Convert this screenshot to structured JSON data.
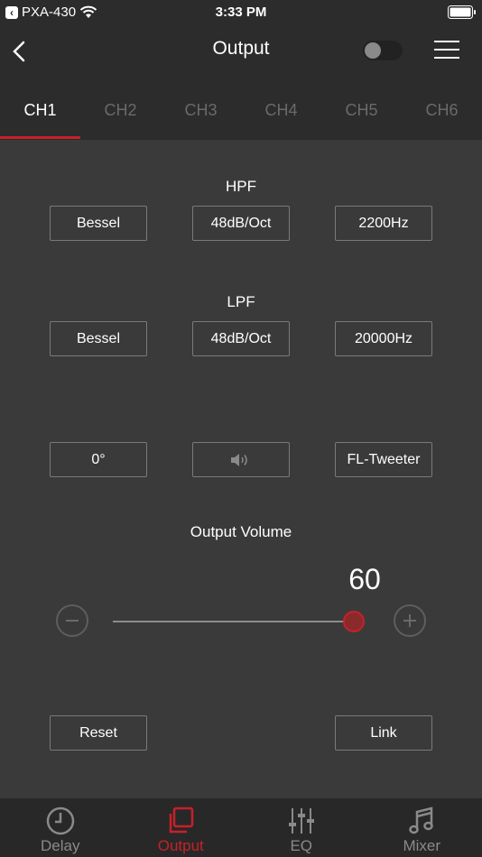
{
  "status_bar": {
    "carrier": "PXA-430",
    "time": "3:33 PM"
  },
  "nav": {
    "title": "Output"
  },
  "tabs": [
    {
      "label": "CH1",
      "active": true
    },
    {
      "label": "CH2"
    },
    {
      "label": "CH3"
    },
    {
      "label": "CH4"
    },
    {
      "label": "CH5"
    },
    {
      "label": "CH6"
    }
  ],
  "hpf": {
    "label": "HPF",
    "type": "Bessel",
    "slope": "48dB/Oct",
    "freq": "2200Hz"
  },
  "lpf": {
    "label": "LPF",
    "type": "Bessel",
    "slope": "48dB/Oct",
    "freq": "20000Hz"
  },
  "phase": "0°",
  "speaker_label": "FL-Tweeter",
  "volume": {
    "label": "Output Volume",
    "value": "60",
    "level_fraction": 0.98
  },
  "actions": {
    "reset": "Reset",
    "link": "Link"
  },
  "bottom_nav": [
    {
      "label": "Delay",
      "icon": "clock-icon"
    },
    {
      "label": "Output",
      "icon": "output-icon",
      "active": true
    },
    {
      "label": "EQ",
      "icon": "eq-sliders-icon"
    },
    {
      "label": "Mixer",
      "icon": "music-note-icon"
    }
  ],
  "colors": {
    "accent": "#c8202a",
    "background": "#3a3a3a",
    "bar": "#2c2c2c"
  }
}
